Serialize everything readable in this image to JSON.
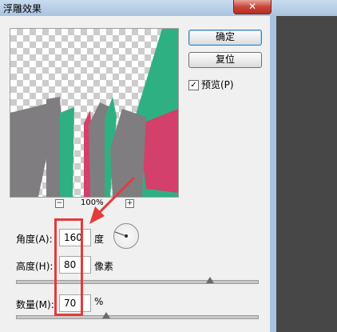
{
  "window": {
    "title": "浮雕效果",
    "close_glyph": "✕"
  },
  "buttons": {
    "ok": "确定",
    "reset": "复位"
  },
  "preview": {
    "label": "预览(P)",
    "checked": true,
    "check_glyph": "✓"
  },
  "zoom": {
    "minus": "−",
    "plus": "+",
    "level": "100%"
  },
  "params": {
    "angle": {
      "label": "角度(A):",
      "value": "160",
      "unit": "度"
    },
    "height": {
      "label": "高度(H):",
      "value": "80",
      "unit": "像素",
      "slider_fraction": 0.8
    },
    "amount": {
      "label": "数量(M):",
      "value": "70",
      "unit": "%",
      "slider_fraction": 0.37
    }
  },
  "colors": {
    "green": "#2fb083",
    "gray": "#7f7d7f",
    "pink": "#d2406b",
    "annotation_red": "#e23b3b"
  }
}
